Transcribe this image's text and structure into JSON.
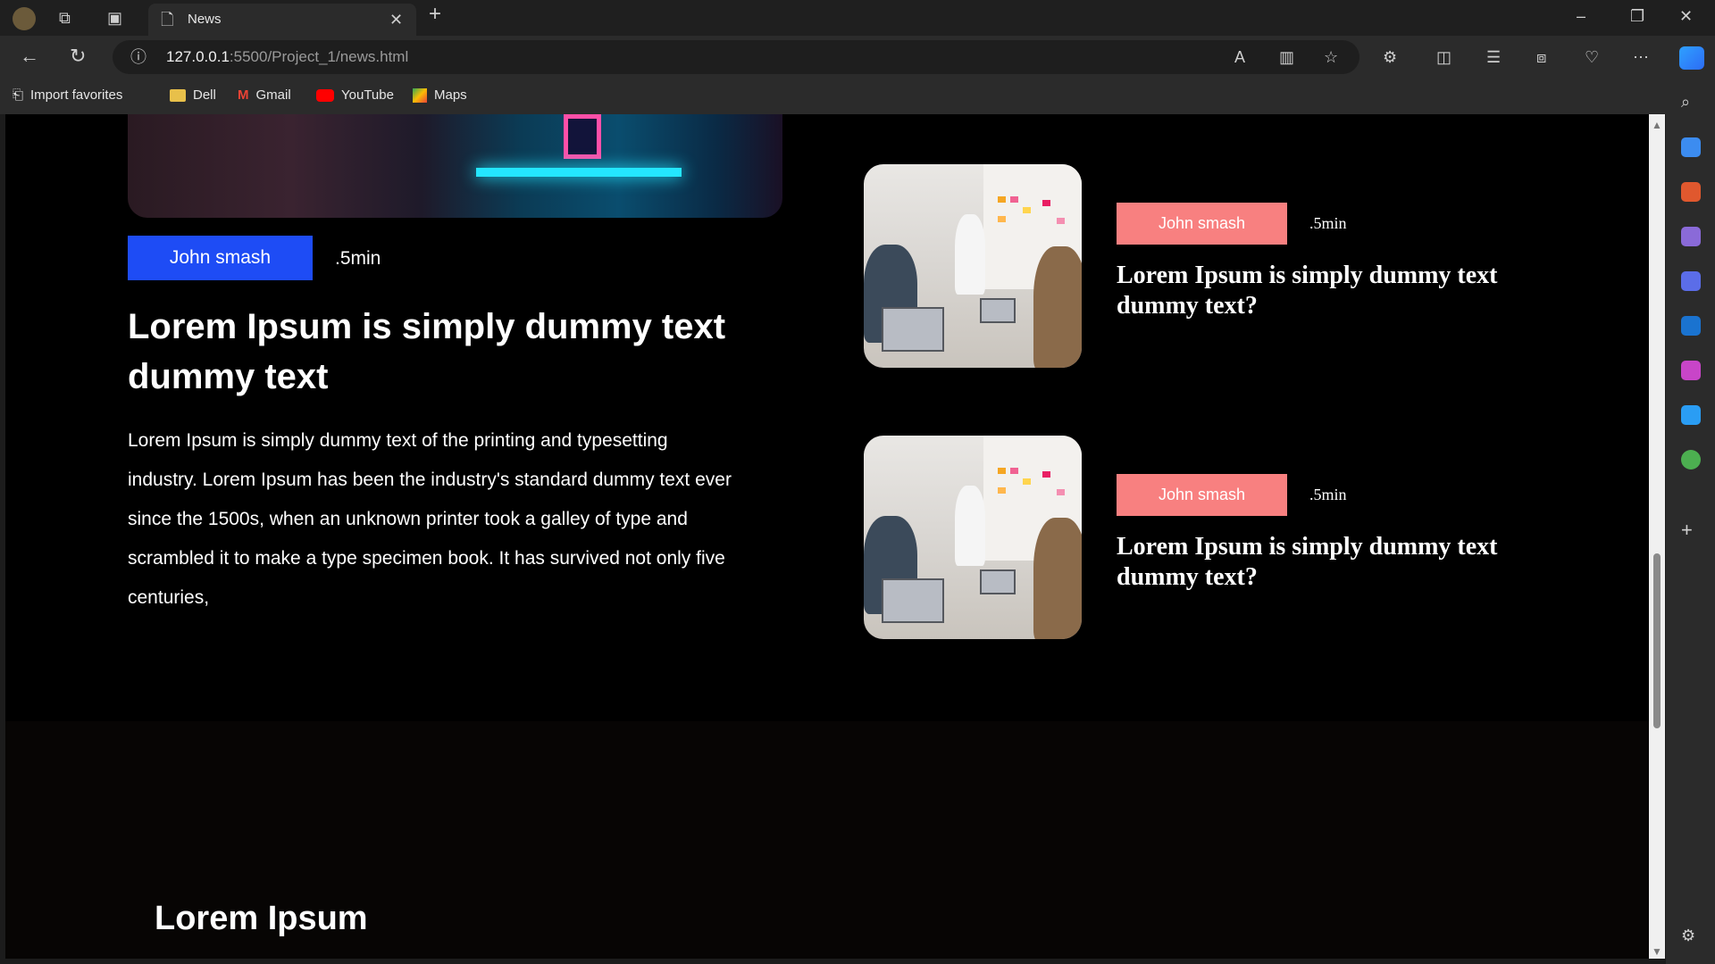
{
  "browser": {
    "tab_title": "News",
    "url_host": "127.0.0.1",
    "url_rest": ":5500/Project_1/news.html",
    "favorites": [
      {
        "label": "Import favorites",
        "icon": "import-icon"
      },
      {
        "label": "Dell",
        "icon": "folder-icon"
      },
      {
        "label": "Gmail",
        "icon": "gmail-icon"
      },
      {
        "label": "YouTube",
        "icon": "youtube-icon"
      },
      {
        "label": "Maps",
        "icon": "maps-icon"
      }
    ]
  },
  "main_article": {
    "author": "John smash",
    "time": ".5min",
    "title": "Lorem Ipsum is simply dummy text dummy text",
    "body": "Lorem Ipsum is simply dummy text of the printing and typesetting industry. Lorem Ipsum has been the industry's standard dummy text ever since the 1500s, when an unknown printer took a galley of type and scrambled it to make a type specimen book. It has survived not only five centuries,"
  },
  "side_articles": [
    {
      "author": "John smash",
      "time": ".5min",
      "title": "Lorem Ipsum is simply dummy text dummy text?"
    },
    {
      "author": "John smash",
      "time": ".5min",
      "title": "Lorem Ipsum is simply dummy text dummy text?"
    }
  ],
  "footer": {
    "title": "Lorem Ipsum"
  },
  "colors": {
    "author_badge_main": "#1e4cf5",
    "author_badge_side": "#f88080",
    "page_bg": "#000000"
  }
}
